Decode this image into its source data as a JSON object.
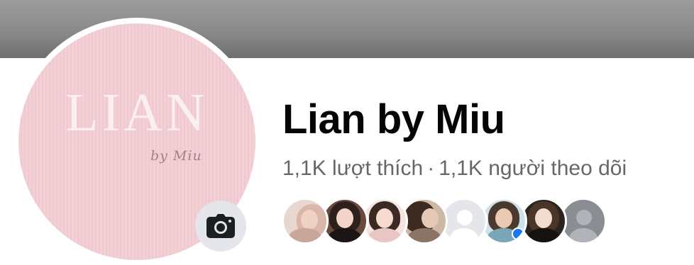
{
  "profile": {
    "name": "Lian by Miu",
    "logo_text": "LIAN",
    "logo_subtext": "by Miu"
  },
  "stats": {
    "likes": "1,1K lượt thích",
    "separator": "·",
    "followers": "1,1K người theo dõi"
  },
  "camera_button": {
    "icon": "camera-icon"
  },
  "friends": [
    {
      "name_hint": "friend-1",
      "type": "photo"
    },
    {
      "name_hint": "friend-2",
      "type": "photo"
    },
    {
      "name_hint": "friend-3",
      "type": "photo"
    },
    {
      "name_hint": "friend-4",
      "type": "photo"
    },
    {
      "name_hint": "friend-5",
      "type": "default-avatar"
    },
    {
      "name_hint": "friend-6",
      "type": "photo",
      "verified": true
    },
    {
      "name_hint": "friend-7",
      "type": "photo"
    },
    {
      "name_hint": "friend-8",
      "type": "default-avatar"
    }
  ],
  "colors": {
    "cover": "#8a8a8a",
    "avatar_bg": "#f3cfd6",
    "name_text": "#050505",
    "secondary_text": "#65676b",
    "camera_button_bg": "#e4e6eb",
    "verified_badge": "#1877f2"
  }
}
